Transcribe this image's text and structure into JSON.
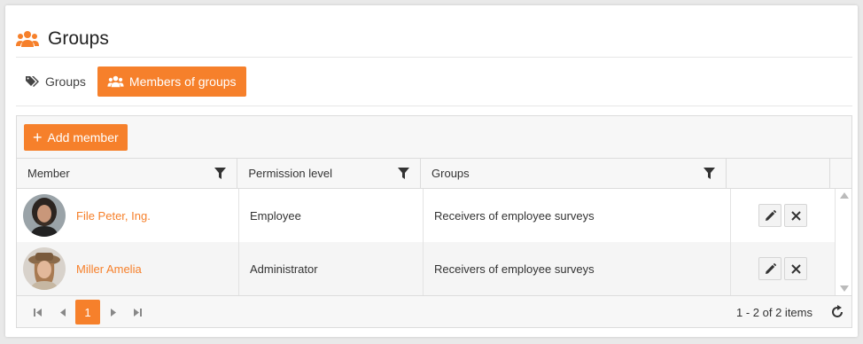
{
  "header": {
    "title": "Groups",
    "icon": "users-icon"
  },
  "tabs": [
    {
      "label": "Groups",
      "icon": "tags-icon",
      "active": false
    },
    {
      "label": "Members of groups",
      "icon": "users-icon",
      "active": true
    }
  ],
  "toolbar": {
    "add_label": "Add member"
  },
  "columns": [
    "Member",
    "Permission level",
    "Groups"
  ],
  "rows": [
    {
      "member": "File Peter, Ing.",
      "permission": "Employee",
      "groups": "Receivers of employee surveys"
    },
    {
      "member": "Miller Amelia",
      "permission": "Administrator",
      "groups": "Receivers of employee surveys"
    }
  ],
  "pager": {
    "current_page": "1",
    "info": "1 - 2 of 2 items"
  },
  "colors": {
    "accent": "#f6802b"
  }
}
